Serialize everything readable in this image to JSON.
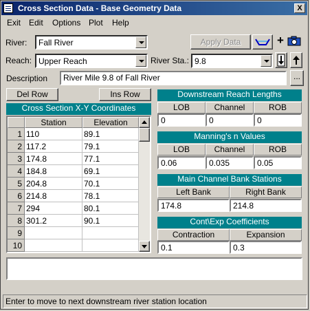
{
  "window": {
    "title": "Cross Section Data - Base Geometry Data",
    "close_label": "X"
  },
  "menu": [
    "Exit",
    "Edit",
    "Options",
    "Plot",
    "Help"
  ],
  "river": {
    "label": "River:",
    "value": "Fall River"
  },
  "reach": {
    "label": "Reach:",
    "value": "Upper Reach"
  },
  "river_sta": {
    "label": "River Sta.:",
    "value": "9.8"
  },
  "apply_label": "Apply Data",
  "plus_label": "+",
  "description": {
    "label": "Description",
    "value": "River Mile 9.8 of Fall River",
    "ellipsis_label": "..."
  },
  "del_row_label": "Del Row",
  "ins_row_label": "Ins Row",
  "xy": {
    "title": "Cross Section X-Y Coordinates",
    "headers": [
      "Station",
      "Elevation"
    ],
    "rows": [
      {
        "n": "1",
        "station": "110",
        "elev": "89.1"
      },
      {
        "n": "2",
        "station": "117.2",
        "elev": "79.1"
      },
      {
        "n": "3",
        "station": "174.8",
        "elev": "77.1"
      },
      {
        "n": "4",
        "station": "184.8",
        "elev": "69.1"
      },
      {
        "n": "5",
        "station": "204.8",
        "elev": "70.1"
      },
      {
        "n": "6",
        "station": "214.8",
        "elev": "78.1"
      },
      {
        "n": "7",
        "station": "294",
        "elev": "80.1"
      },
      {
        "n": "8",
        "station": "301.2",
        "elev": "90.1"
      },
      {
        "n": "9",
        "station": "",
        "elev": ""
      },
      {
        "n": "10",
        "station": "",
        "elev": ""
      }
    ]
  },
  "downstream": {
    "title": "Downstream Reach Lengths",
    "headers": [
      "LOB",
      "Channel",
      "ROB"
    ],
    "values": [
      "0",
      "0",
      "0"
    ]
  },
  "mannings": {
    "title": "Manning's n Values",
    "headers": [
      "LOB",
      "Channel",
      "ROB"
    ],
    "values": [
      "0.06",
      "0.035",
      "0.05"
    ]
  },
  "bank": {
    "title": "Main Channel Bank Stations",
    "headers": [
      "Left Bank",
      "Right Bank"
    ],
    "values": [
      "174.8",
      "214.8"
    ]
  },
  "coeff": {
    "title": "Cont\\Exp  Coefficients",
    "headers": [
      "Contraction",
      "Expansion"
    ],
    "values": [
      "0.1",
      "0.3"
    ]
  },
  "status": "Enter to move to next downstream river station location"
}
